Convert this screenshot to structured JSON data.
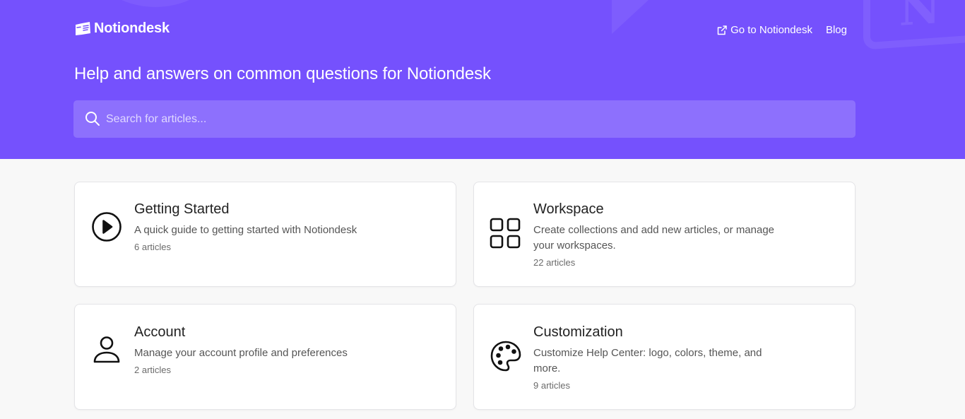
{
  "brand": {
    "name": "Notiondesk"
  },
  "nav": [
    {
      "label": "Go to Notiondesk",
      "icon": "external-link-icon"
    },
    {
      "label": "Blog"
    }
  ],
  "hero": {
    "title": "Help and answers on common questions for Notiondesk",
    "background_color": "#7551fd"
  },
  "search": {
    "placeholder": "Search for articles...",
    "value": "",
    "icon": "search-icon"
  },
  "collections": [
    {
      "title": "Getting Started",
      "description": "A quick guide to getting started with Notiondesk",
      "count": "6 articles",
      "icon": "play-circle-icon"
    },
    {
      "title": "Workspace",
      "description": "Create collections and add new articles, or manage your workspaces.",
      "count": "22 articles",
      "icon": "grid-icon"
    },
    {
      "title": "Account",
      "description": "Manage your account profile and preferences",
      "count": "2 articles",
      "icon": "user-icon"
    },
    {
      "title": "Customization",
      "description": "Customize Help Center: logo, colors, theme, and more.",
      "count": "9 articles",
      "icon": "palette-icon"
    }
  ]
}
